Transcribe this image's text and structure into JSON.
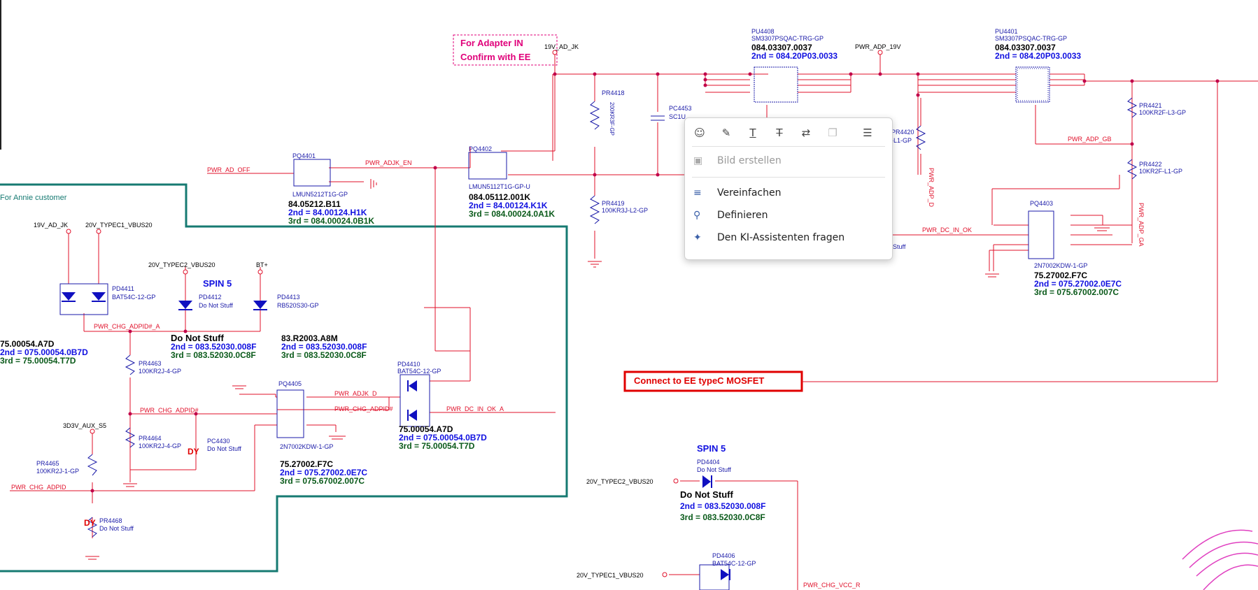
{
  "labels": {
    "note_adapter_1": "For Adapter IN",
    "note_adapter_2": "Confirm with EE",
    "net_19v_adjk": "19V_AD_JK",
    "pu4408_ref": "PU4408",
    "pu4408_part": "SM3307PSQAC-TRG-GP",
    "pu4408_pn": "084.03307.0037",
    "pu4408_2nd": "2nd = 084.20P03.0033",
    "net_pwr_adp_19v": "PWR_ADP_19V",
    "pu4401_ref": "PU4401",
    "pu4401_part": "SM3307PSQAC-TRG-GP",
    "pu4401_pn": "084.03307.0037",
    "pu4401_2nd": "2nd = 084.20P03.0033",
    "pr4418_ref": "PR4418",
    "pr4418_val": "200KR3F-GP",
    "pc4453_ref": "PC4453",
    "pc4453_val": "SC1U...",
    "pr4421_ref": "PR4421",
    "pr4421_val": "100KR2F-L3-GP",
    "pr4422_ref": "PR4422",
    "pr4422_val": "10KR2F-L1-GP",
    "net_pwr_adp_gb": "PWR_ADP_GB",
    "pr4420_ref": "PR4420",
    "pr4420_val": "-L1-GP",
    "net_pwr_adp_d": "PWR_ADP_D",
    "net_pwr_adp_ga": "PWR_ADP_GA",
    "pq4401_ref": "PQ4401",
    "pq4401_part": "LMUN5212T1G-GP",
    "pq4401_pn": "84.05212.B11",
    "pq4401_2nd": "2nd = 84.00124.H1K",
    "pq4401_3rd": "3rd = 084.00024.0B1K",
    "net_pwr_ad_off": "PWR_AD_OFF",
    "net_pwr_adjk_en": "PWR_ADJK_EN",
    "pq4402_ref": "PQ4402",
    "pq4402_part": "LMUN5112T1G-GP-U",
    "pq4402_pn": "084.05112.001K",
    "pq4402_2nd": "2nd = 84.00124.K1K",
    "pq4402_3rd": "3rd = 084.00024.0A1K",
    "pr4419_ref": "PR4419",
    "pr4419_val": "100KR3J-L2-GP",
    "pq4403_ref": "PQ4403",
    "pq4403_part": "2N7002KDW-1-GP",
    "pq4403_pn": "75.27002.F7C",
    "pq4403_2nd": "2nd = 075.27002.0E7C",
    "pq4403_3rd": "3rd = 075.67002.007C",
    "net_pwr_dc_in_ok": "PWR_DC_IN_OK",
    "stuff_frag": "Stuff",
    "annie_note": "For Annie customer",
    "net_typec1_vbus20": "20V_TYPEC1_VBUS20",
    "net_typec2_vbus20": "20V_TYPEC2_VBUS20",
    "net_btplus": "BT+",
    "spin5": "SPIN 5",
    "pd4411_ref": "PD4411",
    "pd4411_part": "BAT54C-12-GP",
    "pd4412_ref": "PD4412",
    "pd4412_part": "Do Not Stuff",
    "pd4413_ref": "PD4413",
    "pd4413_part": "RB520S30-GP",
    "pd4411_pn": "75.00054.A7D",
    "pd4411_2nd": "2nd = 075.00054.0B7D",
    "pd4411_3rd": "3rd = 75.00054.T7D",
    "net_pwr_chg_adpid_a": "PWR_CHG_ADPID#_A",
    "pd4412_dns": "Do Not Stuff",
    "pd4412_2nd": "2nd = 083.52030.008F",
    "pd4412_3rd": "3rd = 083.52030.0C8F",
    "pd4413_pn": "83.R2003.A8M",
    "pd4413_2nd": "2nd = 083.52030.008F",
    "pd4413_3rd": "3rd = 083.52030.0C8F",
    "pr4463_ref": "PR4463",
    "pr4463_val": "100KR2J-4-GP",
    "pq4405_ref": "PQ4405",
    "pq4405_part": "2N7002KDW-1-GP",
    "pq4405_pn": "75.27002.F7C",
    "pq4405_2nd": "2nd = 075.27002.0E7C",
    "pq4405_3rd": "3rd = 075.67002.007C",
    "net_pwr_adjk_d": "PWR_ADJK_D",
    "net_pwr_chg_adpid": "PWR_CHG_ADPID#",
    "net_pwr_chg_adpid_b": "PWR_CHG_ADPID#",
    "pd4410_ref": "PD4410",
    "pd4410_part": "BAT54C-12-GP",
    "pd4410_pn": "75.00054.A7D",
    "pd4410_2nd": "2nd = 075.00054.0B7D",
    "pd4410_3rd": "3rd = 75.00054.T7D",
    "net_pwr_dc_in_ok_a": "PWR_DC_IN_OK_A",
    "net_3v3_aux_s5": "3D3V_AUX_S5",
    "pr4464_ref": "PR4464",
    "pr4464_val": "100KR2J-4-GP",
    "pc4430_ref": "PC4430",
    "pc4430_val": "Do Not Stuff",
    "dy": "DY",
    "pr4465_ref": "PR4465",
    "pr4465_val": "100KR2J-1-GP",
    "net_pwr_chg_adpid2": "PWR_CHG_ADPID",
    "pr4468_ref": "PR4468",
    "pr4468_val": "Do Not Stuff",
    "connect_note": "Connect to EE typeC MOSFET",
    "spin5_b": "SPIN 5",
    "pd4404_ref": "PD4404",
    "pd4404_part": "Do Not Stuff",
    "pd4404_dns": "Do Not Stuff",
    "pd4404_2nd": "2nd = 083.52030.008F",
    "pd4404_3rd": "3rd = 083.52030.0C8F",
    "net_typec2_vbus20_b": "20V_TYPEC2_VBUS20",
    "net_typec1_vbus20_b": "20V_TYPEC1_VBUS20",
    "pd4406_ref": "PD4406",
    "pd4406_part": "BAT54C-12-GP",
    "net_pwr_chg_vcc_r": "PWR_CHG_VCC_R"
  },
  "context_menu": {
    "toolbar_icons": [
      "comment-icon",
      "highlight-icon",
      "underline-icon",
      "strikethrough-icon",
      "replace-text-icon",
      "copy-icon",
      "edit-note-icon"
    ],
    "item_create_image": "Bild erstellen",
    "item_simplify": "Vereinfachen",
    "item_define": "Definieren",
    "item_ask_ai": "Den KI-Assistenten fragen"
  },
  "colors": {
    "wire": "#e0102a",
    "component": "#1a1aa8",
    "part_text": "#000000",
    "second_source": "#1010e0",
    "third_source": "#0a5a1a",
    "annie_border": "#167a72",
    "note_pink": "#e0007a",
    "connect_box": "#e00000"
  }
}
